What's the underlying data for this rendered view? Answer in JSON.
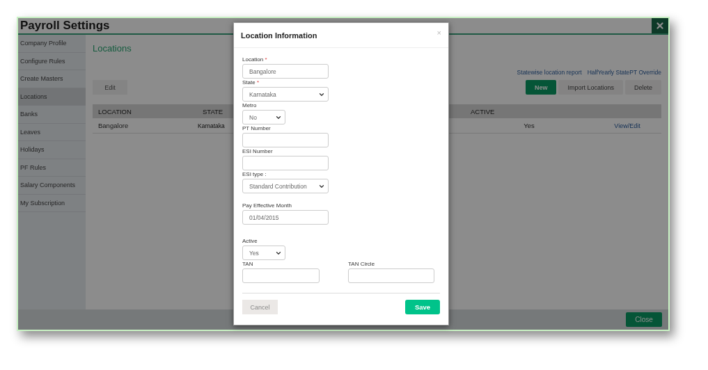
{
  "window": {
    "title": "Payroll Settings"
  },
  "sidebar": {
    "items": [
      {
        "label": "Company Profile",
        "selected": false
      },
      {
        "label": "Configure Rules",
        "selected": false
      },
      {
        "label": "Create Masters",
        "selected": false
      },
      {
        "label": "Locations",
        "selected": true
      },
      {
        "label": "Banks",
        "selected": false
      },
      {
        "label": "Leaves",
        "selected": false
      },
      {
        "label": "Holidays",
        "selected": false
      },
      {
        "label": "PF Rules",
        "selected": false
      },
      {
        "label": "Salary Components",
        "selected": false
      },
      {
        "label": "My Subscription",
        "selected": false
      }
    ]
  },
  "page": {
    "heading": "Locations",
    "links": [
      "Statewise location report",
      "HalfYearly StatePT Override"
    ],
    "edit_button": {
      "label": "Edit",
      "disabled": true
    },
    "actions": [
      {
        "label": "New",
        "kind": "primary"
      },
      {
        "label": "Import Locations",
        "kind": "disabled"
      },
      {
        "label": "Delete",
        "kind": "disabled"
      }
    ]
  },
  "table": {
    "columns": [
      "LOCATION",
      "STATE",
      "ACTIVE"
    ],
    "rows": [
      {
        "location": "Bangalore",
        "state": "Karnataka",
        "active": "Yes",
        "action": "View/Edit"
      }
    ]
  },
  "footer": {
    "close": "Close"
  },
  "modal": {
    "title": "Location Information",
    "close": "×",
    "fields": [
      {
        "kind": "text",
        "label": "Location",
        "required_mark": "*",
        "value": "Bangalore",
        "narrow": false
      },
      {
        "kind": "select",
        "label": "State",
        "required_mark": "*",
        "value": "Karnataka",
        "narrow": false
      },
      {
        "kind": "select",
        "label": "Metro",
        "value": "No",
        "narrow": true
      },
      {
        "kind": "text",
        "label": "PT Number",
        "narrow": false
      },
      {
        "kind": "text",
        "label": "ESI Number",
        "narrow": false
      },
      {
        "kind": "select",
        "label": "ESI type :",
        "value": "Standard Contribution",
        "narrow": false
      },
      {
        "kind": "date",
        "label": "Pay Effective Month",
        "value": "01/04/2015",
        "narrow": false
      },
      {
        "kind": "select",
        "label": "Active",
        "value": "Yes",
        "narrow": true
      }
    ],
    "pair": [
      {
        "label": "TAN"
      },
      {
        "label": "TAN Circle"
      }
    ],
    "cancel": {
      "label": "Cancel",
      "disabled": true
    },
    "save": "Save"
  }
}
